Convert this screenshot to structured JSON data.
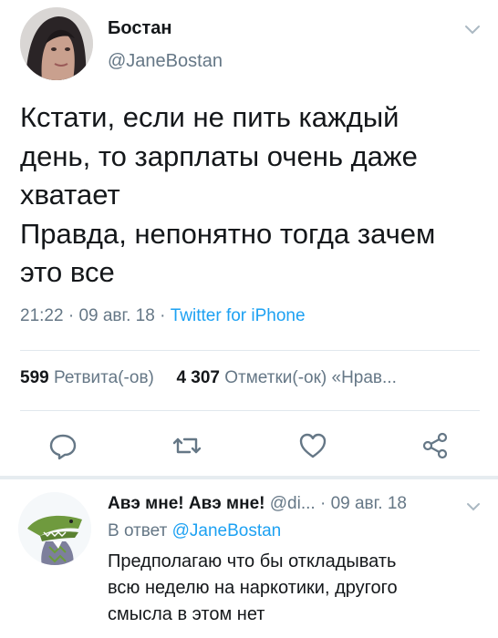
{
  "tweet": {
    "author_name": "Бостан",
    "author_handle": "@JaneBostan",
    "text_lines": [
      "Кстати, если не пить каждый",
      "день, то зарплаты очень даже",
      "хватает",
      "Правда, непонятно тогда зачем",
      "это все"
    ],
    "time": "21:22",
    "date": "09 авг. 18",
    "source": "Twitter for iPhone",
    "retweet_count": "599",
    "retweet_label": "Ретвита(-ов)",
    "like_count": "4 307",
    "like_label": "Отметки(-ок) «Нрав..."
  },
  "actions": {
    "icons": [
      "reply-icon",
      "retweet-icon",
      "like-icon",
      "share-icon"
    ]
  },
  "reply": {
    "author_name": "Авэ мне! Авэ мне!",
    "author_handle": "@di...",
    "date": "09 авг. 18",
    "in_reply_to_prefix": "В ответ",
    "in_reply_to_handle": "@JaneBostan",
    "text_lines": [
      "Предполагаю что бы откладывать",
      "всю неделю на наркотики, другого",
      "смысла в этом нет"
    ]
  },
  "colors": {
    "link": "#1da1f2",
    "secondary_text": "#657786",
    "primary_text": "#14171a",
    "divider": "#e1e8ed"
  }
}
